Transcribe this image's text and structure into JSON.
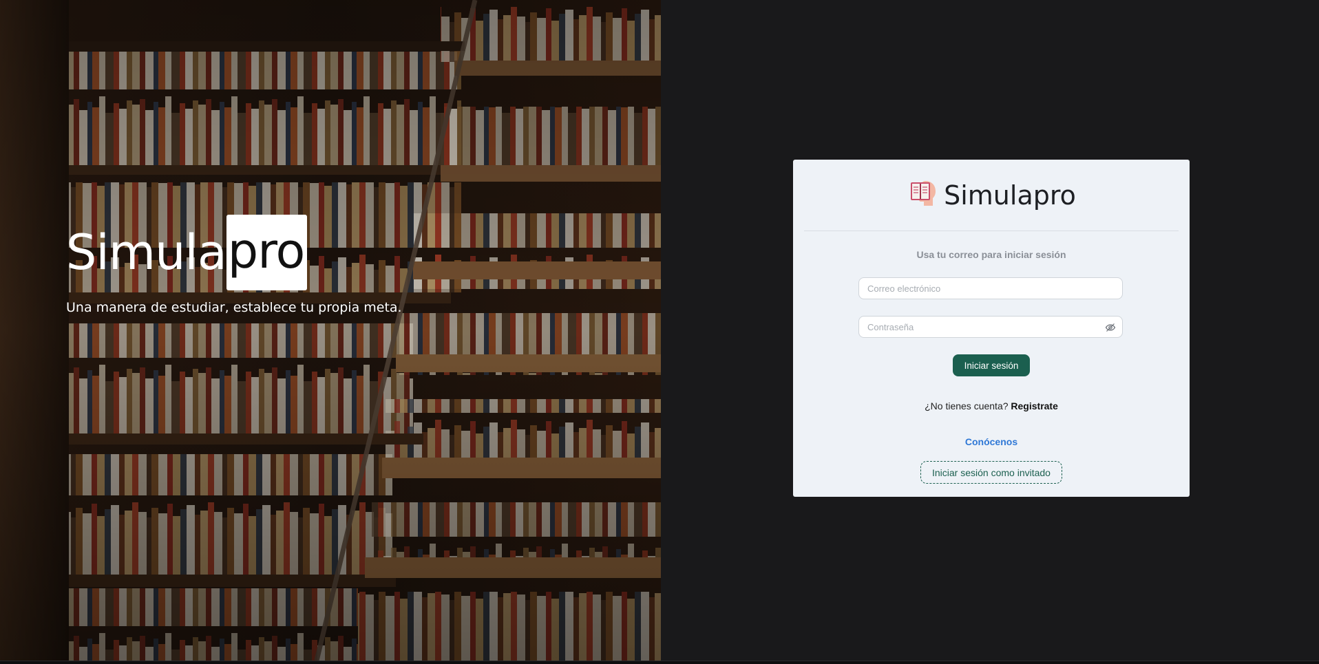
{
  "hero": {
    "brand_part1": "Simula",
    "brand_part2": "pro",
    "tagline": "Una manera de estudiar, establece tu propia meta."
  },
  "card": {
    "logo_icon": "book-head-icon",
    "title": "Simulapro",
    "subtitle": "Usa tu correo para iniciar sesión",
    "email_placeholder": "Correo electrónico",
    "password_placeholder": "Contraseña",
    "password_toggle_icon": "eye-slash-icon",
    "login_button": "Iniciar sesión",
    "signup_prompt": "¿No tienes cuenta?",
    "signup_link": "Registrate",
    "about_link": "Conócenos",
    "guest_button": "Iniciar sesión como invitado"
  },
  "colors": {
    "page_background": "#19191b",
    "card_background": "#eef2f7",
    "primary": "#1b5f4f",
    "link": "#2f78d6"
  }
}
